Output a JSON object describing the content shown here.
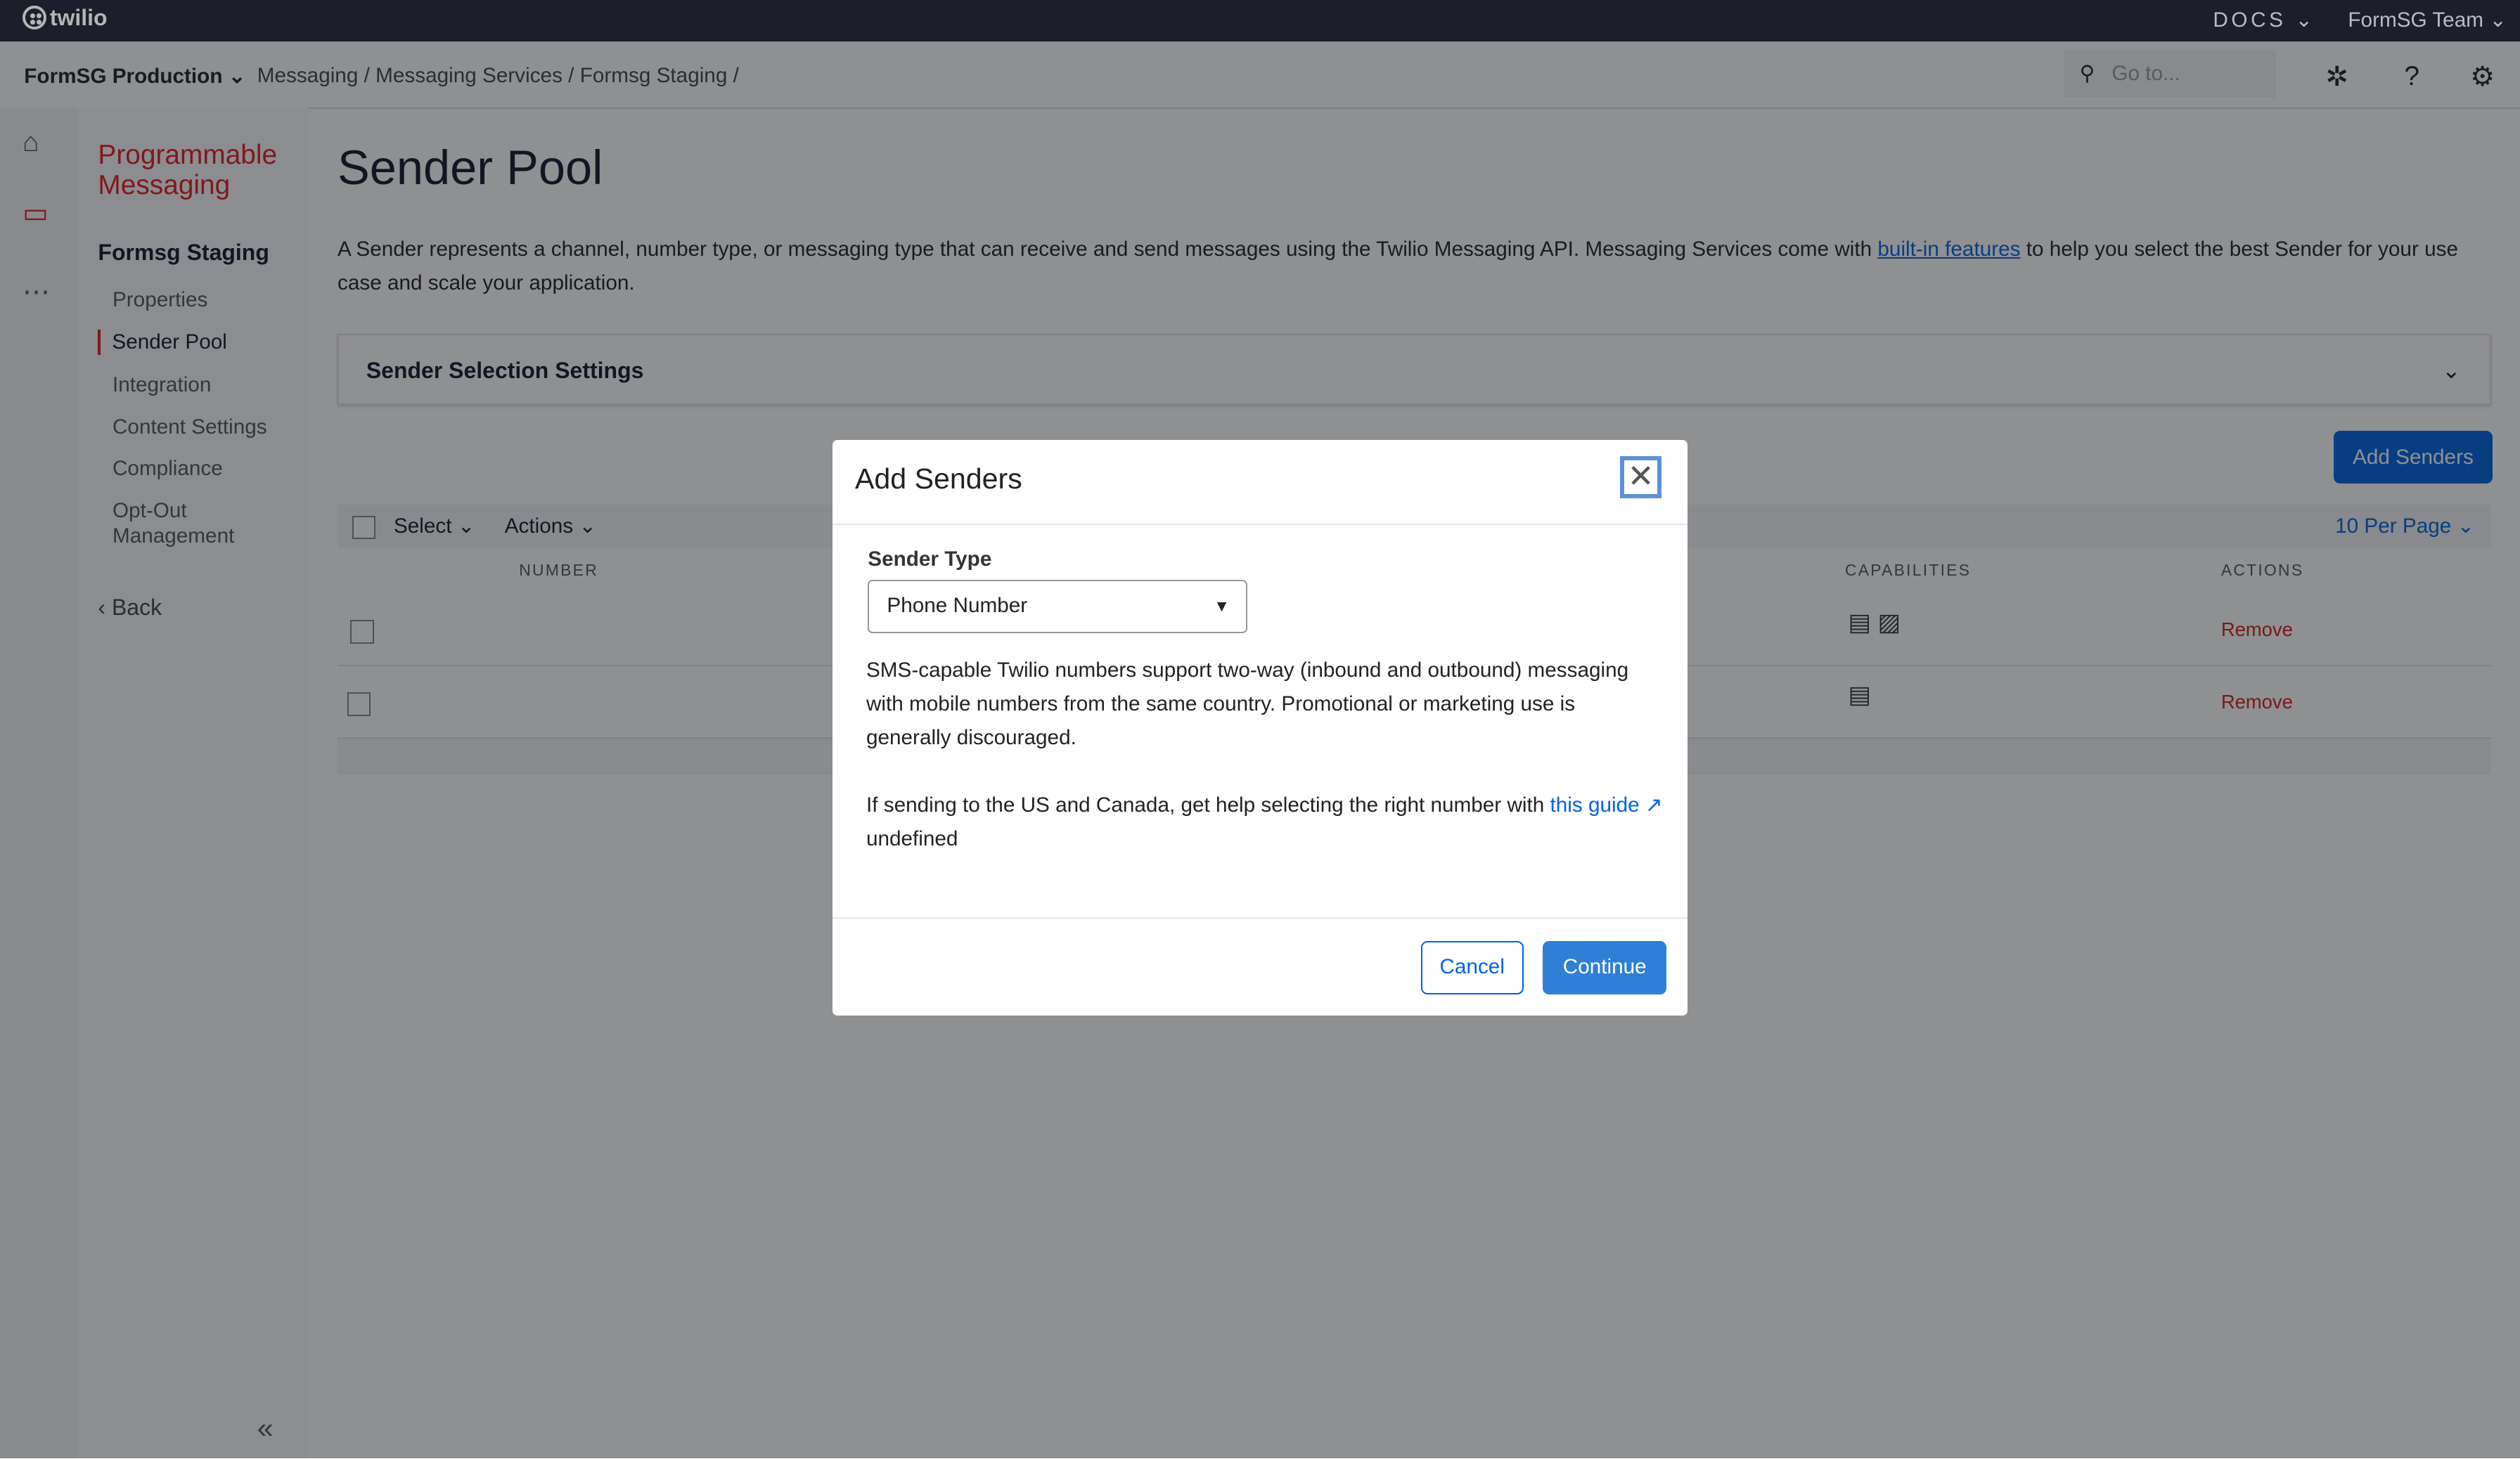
{
  "topbar": {
    "logo": "twilio",
    "docs": "DOCS",
    "team": "FormSG Team"
  },
  "subbar": {
    "account": "FormSG Production",
    "breadcrumbs": [
      "Messaging",
      "Messaging Services",
      "Formsg Staging"
    ],
    "search_placeholder": "Go to..."
  },
  "nav": {
    "product": "Programmable Messaging",
    "service": "Formsg Staging",
    "items": [
      "Properties",
      "Sender Pool",
      "Integration",
      "Content Settings",
      "Compliance",
      "Opt-Out Management"
    ],
    "active": "Sender Pool",
    "back": "Back"
  },
  "main": {
    "title": "Sender Pool",
    "desc_pre": "A Sender represents a channel, number type, or messaging type that can receive and send messages using the Twilio Messaging API. Messaging Services come with ",
    "desc_link": "built-in features",
    "desc_post": " to help you select the best Sender for your use case and scale your application.",
    "accordion": "Sender Selection Settings",
    "add_senders": "Add Senders",
    "select": "Select",
    "actions": "Actions",
    "per_page": "10 Per Page",
    "columns": {
      "number": "NUMBER",
      "capabilities": "CAPABILITIES",
      "actions": "ACTIONS"
    },
    "rows": [
      {
        "capabilities": [
          "sms-icon",
          "mms-icon"
        ],
        "action": "Remove"
      },
      {
        "capabilities": [
          "sms-icon"
        ],
        "action": "Remove"
      }
    ]
  },
  "modal": {
    "title": "Add Senders",
    "sender_type_label": "Sender Type",
    "sender_type_value": "Phone Number",
    "p1": "SMS-capable Twilio numbers support two-way (inbound and outbound) messaging with mobile numbers from the same country. Promotional or marketing use is generally discouraged.",
    "p2_pre": "If sending to the US and Canada, get help selecting the right number with ",
    "p2_link": "this guide ↗",
    "p2_post": "undefined",
    "cancel": "Cancel",
    "continue": "Continue"
  },
  "colors": {
    "accent": "#0263e0",
    "brand": "#e31e26",
    "topbar": "#1c1e2b"
  }
}
